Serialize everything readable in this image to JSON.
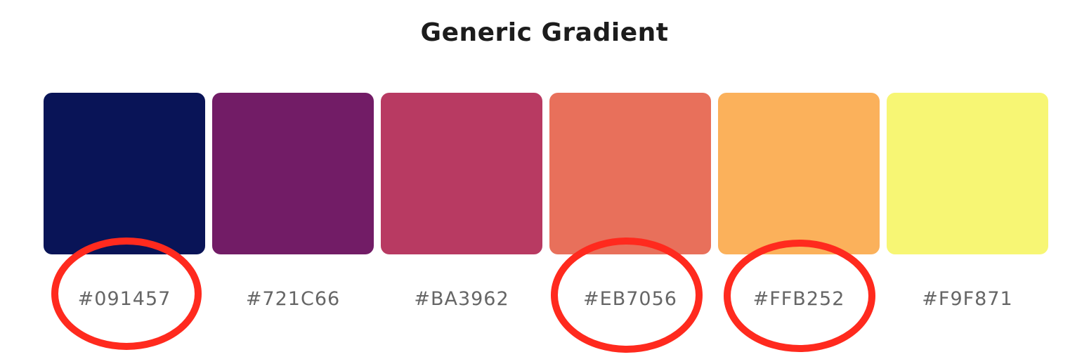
{
  "title": "Generic Gradient",
  "swatches": [
    {
      "hex": "#091457",
      "color": "#091457",
      "circled": true
    },
    {
      "hex": "#721C66",
      "color": "#721C66",
      "circled": false
    },
    {
      "hex": "#BA3962",
      "color": "#B83A62",
      "circled": false
    },
    {
      "hex": "#EB7056",
      "color": "#E8705B",
      "circled": true
    },
    {
      "hex": "#FFB252",
      "color": "#FBB15B",
      "circled": true
    },
    {
      "hex": "#F9F871",
      "color": "#F7F674",
      "circled": false
    }
  ],
  "annotation_color": "#FF2A1E"
}
